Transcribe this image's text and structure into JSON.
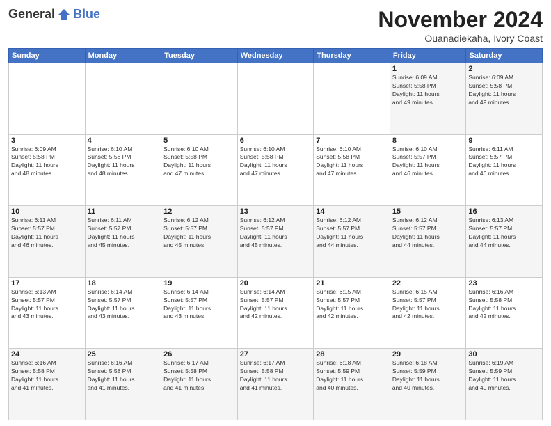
{
  "logo": {
    "general": "General",
    "blue": "Blue"
  },
  "header": {
    "month": "November 2024",
    "location": "Ouanadiekaha, Ivory Coast"
  },
  "weekdays": [
    "Sunday",
    "Monday",
    "Tuesday",
    "Wednesday",
    "Thursday",
    "Friday",
    "Saturday"
  ],
  "weeks": [
    [
      {
        "day": "",
        "info": ""
      },
      {
        "day": "",
        "info": ""
      },
      {
        "day": "",
        "info": ""
      },
      {
        "day": "",
        "info": ""
      },
      {
        "day": "",
        "info": ""
      },
      {
        "day": "1",
        "info": "Sunrise: 6:09 AM\nSunset: 5:58 PM\nDaylight: 11 hours and 49 minutes."
      },
      {
        "day": "2",
        "info": "Sunrise: 6:09 AM\nSunset: 5:58 PM\nDaylight: 11 hours and 49 minutes."
      }
    ],
    [
      {
        "day": "3",
        "info": "Sunrise: 6:09 AM\nSunset: 5:58 PM\nDaylight: 11 hours and 48 minutes."
      },
      {
        "day": "4",
        "info": "Sunrise: 6:10 AM\nSunset: 5:58 PM\nDaylight: 11 hours and 48 minutes."
      },
      {
        "day": "5",
        "info": "Sunrise: 6:10 AM\nSunset: 5:58 PM\nDaylight: 11 hours and 47 minutes."
      },
      {
        "day": "6",
        "info": "Sunrise: 6:10 AM\nSunset: 5:58 PM\nDaylight: 11 hours and 47 minutes."
      },
      {
        "day": "7",
        "info": "Sunrise: 6:10 AM\nSunset: 5:58 PM\nDaylight: 11 hours and 47 minutes."
      },
      {
        "day": "8",
        "info": "Sunrise: 6:10 AM\nSunset: 5:57 PM\nDaylight: 11 hours and 46 minutes."
      },
      {
        "day": "9",
        "info": "Sunrise: 6:11 AM\nSunset: 5:57 PM\nDaylight: 11 hours and 46 minutes."
      }
    ],
    [
      {
        "day": "10",
        "info": "Sunrise: 6:11 AM\nSunset: 5:57 PM\nDaylight: 11 hours and 46 minutes."
      },
      {
        "day": "11",
        "info": "Sunrise: 6:11 AM\nSunset: 5:57 PM\nDaylight: 11 hours and 45 minutes."
      },
      {
        "day": "12",
        "info": "Sunrise: 6:12 AM\nSunset: 5:57 PM\nDaylight: 11 hours and 45 minutes."
      },
      {
        "day": "13",
        "info": "Sunrise: 6:12 AM\nSunset: 5:57 PM\nDaylight: 11 hours and 45 minutes."
      },
      {
        "day": "14",
        "info": "Sunrise: 6:12 AM\nSunset: 5:57 PM\nDaylight: 11 hours and 44 minutes."
      },
      {
        "day": "15",
        "info": "Sunrise: 6:12 AM\nSunset: 5:57 PM\nDaylight: 11 hours and 44 minutes."
      },
      {
        "day": "16",
        "info": "Sunrise: 6:13 AM\nSunset: 5:57 PM\nDaylight: 11 hours and 44 minutes."
      }
    ],
    [
      {
        "day": "17",
        "info": "Sunrise: 6:13 AM\nSunset: 5:57 PM\nDaylight: 11 hours and 43 minutes."
      },
      {
        "day": "18",
        "info": "Sunrise: 6:14 AM\nSunset: 5:57 PM\nDaylight: 11 hours and 43 minutes."
      },
      {
        "day": "19",
        "info": "Sunrise: 6:14 AM\nSunset: 5:57 PM\nDaylight: 11 hours and 43 minutes."
      },
      {
        "day": "20",
        "info": "Sunrise: 6:14 AM\nSunset: 5:57 PM\nDaylight: 11 hours and 42 minutes."
      },
      {
        "day": "21",
        "info": "Sunrise: 6:15 AM\nSunset: 5:57 PM\nDaylight: 11 hours and 42 minutes."
      },
      {
        "day": "22",
        "info": "Sunrise: 6:15 AM\nSunset: 5:57 PM\nDaylight: 11 hours and 42 minutes."
      },
      {
        "day": "23",
        "info": "Sunrise: 6:16 AM\nSunset: 5:58 PM\nDaylight: 11 hours and 42 minutes."
      }
    ],
    [
      {
        "day": "24",
        "info": "Sunrise: 6:16 AM\nSunset: 5:58 PM\nDaylight: 11 hours and 41 minutes."
      },
      {
        "day": "25",
        "info": "Sunrise: 6:16 AM\nSunset: 5:58 PM\nDaylight: 11 hours and 41 minutes."
      },
      {
        "day": "26",
        "info": "Sunrise: 6:17 AM\nSunset: 5:58 PM\nDaylight: 11 hours and 41 minutes."
      },
      {
        "day": "27",
        "info": "Sunrise: 6:17 AM\nSunset: 5:58 PM\nDaylight: 11 hours and 41 minutes."
      },
      {
        "day": "28",
        "info": "Sunrise: 6:18 AM\nSunset: 5:59 PM\nDaylight: 11 hours and 40 minutes."
      },
      {
        "day": "29",
        "info": "Sunrise: 6:18 AM\nSunset: 5:59 PM\nDaylight: 11 hours and 40 minutes."
      },
      {
        "day": "30",
        "info": "Sunrise: 6:19 AM\nSunset: 5:59 PM\nDaylight: 11 hours and 40 minutes."
      }
    ]
  ]
}
